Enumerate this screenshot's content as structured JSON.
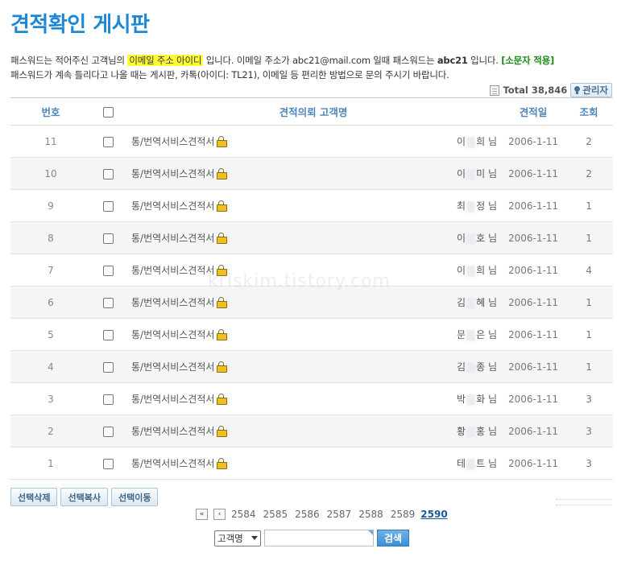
{
  "page": {
    "title": "견적확인 게시판",
    "notice_line1_a": "패스워드는 적어주신 고객님의 ",
    "notice_line1_highlight": "이메일 주소 아이디",
    "notice_line1_b": " 입니다. 이메일 주소가 abc21@mail.com 일때 패스워드는 ",
    "notice_line1_bold": "abc21",
    "notice_line1_c": " 입니다. ",
    "notice_line1_green": "[소문자 적용]",
    "notice_line2": "패스워드가 계속 틀리다고 나올 때는 게시판, 카톡(아이디: TL21), 이메일 등 편리한 방법으로 문의 주시기 바랍니다.",
    "total_label": "Total 38,846",
    "admin_label": "관리자",
    "watermark": "kriskim.tistory.com"
  },
  "table": {
    "headers": {
      "num": "번호",
      "title": "견적의뢰 고객명",
      "date": "견적일",
      "hits": "조회"
    },
    "rows": [
      {
        "num": "11",
        "title": "통/번역서비스견적서",
        "name_first": "이",
        "name_last": "희",
        "suffix": "님",
        "date": "2006-1-11",
        "hits": "2"
      },
      {
        "num": "10",
        "title": "통/번역서비스견적서",
        "name_first": "이",
        "name_last": "미",
        "suffix": "님",
        "date": "2006-1-11",
        "hits": "2"
      },
      {
        "num": "9",
        "title": "통/번역서비스견적서",
        "name_first": "최",
        "name_last": "정",
        "suffix": "님",
        "date": "2006-1-11",
        "hits": "1"
      },
      {
        "num": "8",
        "title": "통/번역서비스견적서",
        "name_first": "이",
        "name_last": "호",
        "suffix": "님",
        "date": "2006-1-11",
        "hits": "1"
      },
      {
        "num": "7",
        "title": "통/번역서비스견적서",
        "name_first": "이",
        "name_last": "희",
        "suffix": "님",
        "date": "2006-1-11",
        "hits": "4"
      },
      {
        "num": "6",
        "title": "통/번역서비스견적서",
        "name_first": "김",
        "name_last": "혜",
        "suffix": "님",
        "date": "2006-1-11",
        "hits": "1"
      },
      {
        "num": "5",
        "title": "통/번역서비스견적서",
        "name_first": "문",
        "name_last": "은",
        "suffix": "님",
        "date": "2006-1-11",
        "hits": "1"
      },
      {
        "num": "4",
        "title": "통/번역서비스견적서",
        "name_first": "김",
        "name_last": "종",
        "suffix": "님",
        "date": "2006-1-11",
        "hits": "1"
      },
      {
        "num": "3",
        "title": "통/번역서비스견적서",
        "name_first": "박",
        "name_last": "화",
        "suffix": "님",
        "date": "2006-1-11",
        "hits": "3"
      },
      {
        "num": "2",
        "title": "통/번역서비스견적서",
        "name_first": "황",
        "name_last": "홍",
        "suffix": "님",
        "date": "2006-1-11",
        "hits": "3"
      },
      {
        "num": "1",
        "title": "통/번역서비스견적서",
        "name_first": "테",
        "name_last": "트",
        "suffix": "님",
        "date": "2006-1-11",
        "hits": "3"
      }
    ]
  },
  "actions": {
    "delete": "선택삭제",
    "copy": "선택복사",
    "move": "선택이동"
  },
  "pager": {
    "first": "«",
    "prev": "‹",
    "pages": [
      "2584",
      "2585",
      "2586",
      "2587",
      "2588",
      "2589"
    ],
    "current": "2590"
  },
  "search": {
    "select_value": "고객명",
    "button": "검색",
    "query": ""
  },
  "colors": {
    "title": "#1e88d6",
    "header_text": "#4f86b8",
    "highlight": "#ffff33",
    "green_note": "#1a8a1a",
    "row_alt": "#f5f5f5"
  }
}
